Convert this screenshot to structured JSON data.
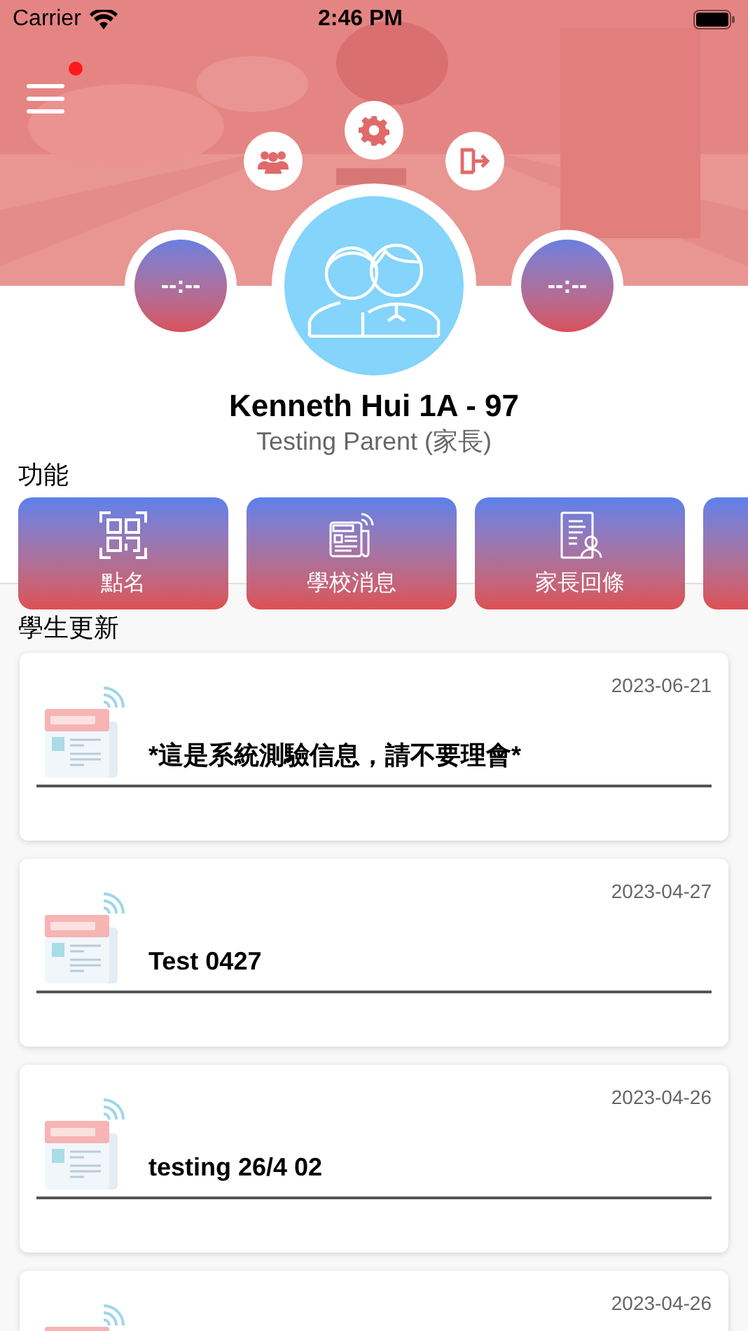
{
  "status_bar": {
    "carrier": "Carrier",
    "time": "2:46 PM"
  },
  "header": {
    "menu_badge": true,
    "timers": [
      "--:--",
      "--:--"
    ]
  },
  "profile": {
    "name": "Kenneth Hui 1A - 97",
    "role": "Testing Parent (家長)"
  },
  "features": {
    "title": "功能",
    "items": [
      {
        "kind": "qr",
        "label": "點名"
      },
      {
        "kind": "news",
        "label": "學校消息"
      },
      {
        "kind": "reply",
        "label": "家長回條"
      },
      {
        "kind": "blank"
      }
    ]
  },
  "updates": {
    "title": "學生更新",
    "items": [
      {
        "date": "2023-06-21",
        "title": "*這是系統測驗信息，請不要理會*"
      },
      {
        "date": "2023-04-27",
        "title": "Test 0427"
      },
      {
        "date": "2023-04-26",
        "title": "testing 26/4 02"
      },
      {
        "date": "2023-04-26"
      }
    ]
  }
}
